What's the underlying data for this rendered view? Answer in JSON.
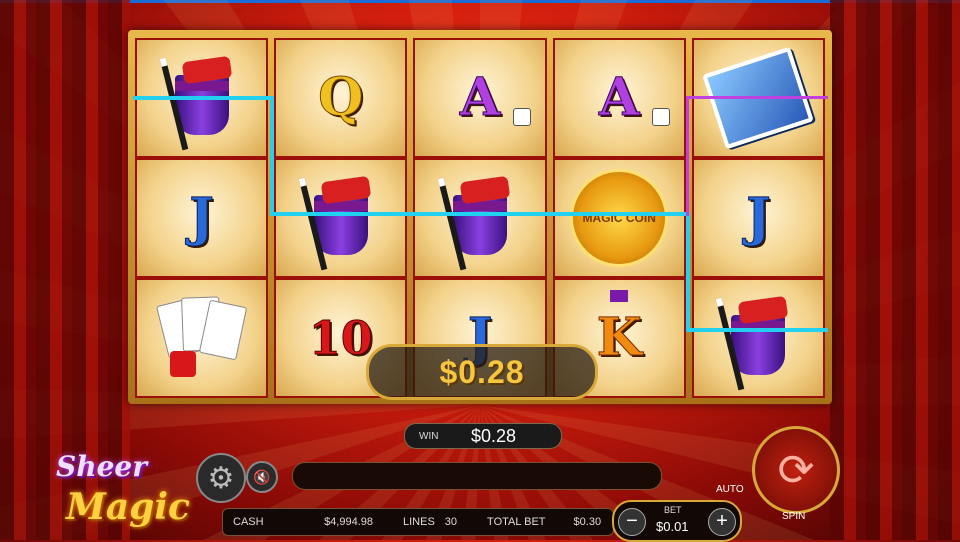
{
  "game": {
    "logo_line1": "Sheer",
    "logo_line2": "Magic"
  },
  "reels": [
    [
      {
        "symbol": "magic-hat"
      },
      {
        "symbol": "J"
      },
      {
        "symbol": "cards-and-dice"
      }
    ],
    [
      {
        "symbol": "Q"
      },
      {
        "symbol": "magic-hat"
      },
      {
        "symbol": "10"
      }
    ],
    [
      {
        "symbol": "A"
      },
      {
        "symbol": "magic-hat"
      },
      {
        "symbol": "J"
      }
    ],
    [
      {
        "symbol": "A"
      },
      {
        "symbol": "magic-coin",
        "text": "MAGIC COIN"
      },
      {
        "symbol": "K"
      }
    ],
    [
      {
        "symbol": "spell-book"
      },
      {
        "symbol": "J"
      },
      {
        "symbol": "magic-hat"
      }
    ]
  ],
  "win_overlay": {
    "amount": "$0.28"
  },
  "win_display": {
    "label": "WIN",
    "amount": "$0.28"
  },
  "status": {
    "cash_label": "CASH",
    "cash_value": "$4,994.98",
    "lines_label": "LINES",
    "lines_value": "30",
    "total_bet_label": "TOTAL BET",
    "total_bet_value": "$0.30"
  },
  "bet": {
    "label": "BET",
    "value": "$0.01",
    "minus": "−",
    "plus": "+"
  },
  "controls": {
    "auto_label": "AUTO",
    "spin_label": "SPIN"
  },
  "colors": {
    "winline_cyan": "#22d0f0",
    "payline_purple": "#c040e0",
    "gold": "#d8a838"
  }
}
